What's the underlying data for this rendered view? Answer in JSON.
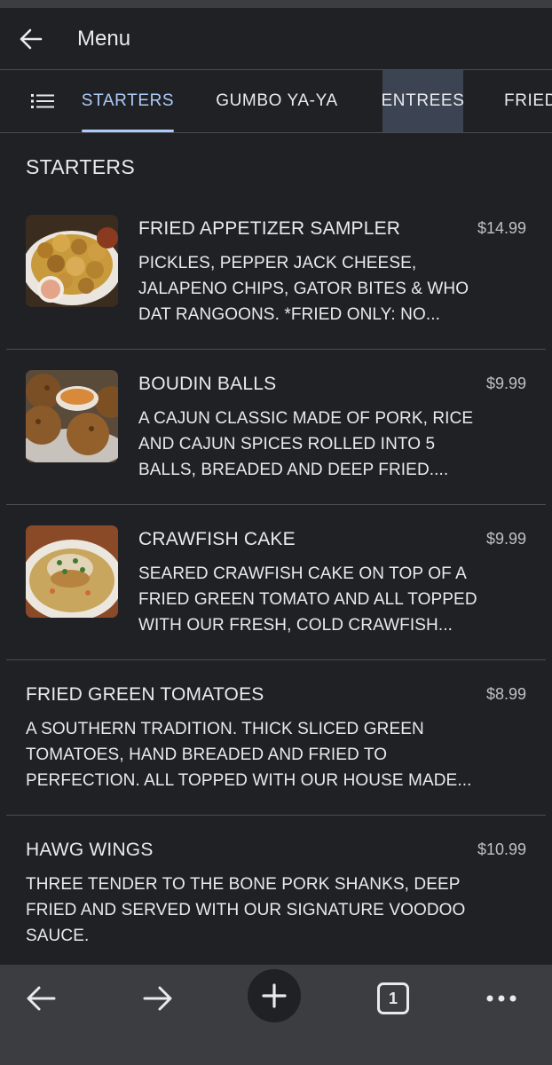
{
  "app_bar": {
    "title": "Menu"
  },
  "tabs": [
    {
      "label": "STARTERS"
    },
    {
      "label": "GUMBO YA-YA"
    },
    {
      "label": "ENTREES"
    },
    {
      "label": "FRIED"
    }
  ],
  "section": {
    "title": "STARTERS"
  },
  "items": [
    {
      "name": "FRIED APPETIZER SAMPLER",
      "price": "$14.99",
      "desc1": "PICKLES, PEPPER JACK CHEESE,",
      "desc2": "JALAPENO CHIPS, GATOR BITES & WHO",
      "desc3": "DAT RANGOONS. *FRIED ONLY: NO..."
    },
    {
      "name": "BOUDIN BALLS",
      "price": "$9.99",
      "desc1": "A CAJUN CLASSIC MADE OF PORK, RICE",
      "desc2": "AND CAJUN SPICES ROLLED INTO 5",
      "desc3": "BALLS, BREADED AND DEEP FRIED...."
    },
    {
      "name": "CRAWFISH CAKE",
      "price": "$9.99",
      "desc1": "SEARED CRAWFISH CAKE ON TOP OF A",
      "desc2": "FRIED GREEN TOMATO AND ALL TOPPED",
      "desc3": "WITH OUR FRESH, COLD CRAWFISH..."
    },
    {
      "name": "FRIED GREEN TOMATOES",
      "price": "$8.99",
      "desc1": "A SOUTHERN TRADITION. THICK SLICED GREEN",
      "desc2": "TOMATOES, HAND BREADED AND FRIED TO",
      "desc3": "PERFECTION. ALL TOPPED WITH OUR HOUSE MADE..."
    },
    {
      "name": "HAWG WINGS",
      "price": "$10.99",
      "desc1": "THREE TENDER TO THE BONE PORK SHANKS, DEEP",
      "desc2": "FRIED AND SERVED WITH OUR SIGNATURE VOODOO",
      "desc3": "SAUCE."
    }
  ],
  "browser_bar": {
    "tab_count": "1"
  },
  "icons": {
    "back": "arrow-left-icon",
    "list": "list-icon",
    "forward": "arrow-right-icon",
    "new_tab": "plus-icon",
    "tabs": "tab-switcher-icon",
    "more": "more-dots-icon"
  },
  "colors": {
    "background": "#202124",
    "accent": "#aecbfa",
    "bar": "#3c3d40"
  }
}
